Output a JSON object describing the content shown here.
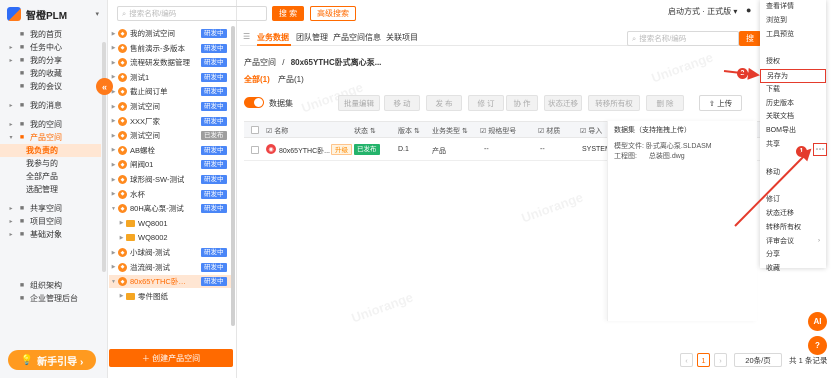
{
  "app": {
    "name": "智橙PLM"
  },
  "nav": {
    "items": [
      {
        "label": "我的首页",
        "icon": "home-icon"
      },
      {
        "label": "任务中心",
        "icon": "task-icon",
        "arrow": "▸"
      },
      {
        "label": "我的分享",
        "icon": "share-icon",
        "arrow": "▸"
      },
      {
        "label": "我的收藏",
        "icon": "star-icon"
      },
      {
        "label": "我的会议",
        "icon": "meeting-icon"
      },
      {
        "label": "我的消息",
        "icon": "message-icon",
        "arrow": "▸"
      },
      {
        "label": "我的空间",
        "icon": "space-icon",
        "arrow": "▸"
      },
      {
        "label": "产品空间",
        "icon": "product-icon",
        "arrow": "▾"
      },
      {
        "label": "我负责的"
      },
      {
        "label": "我参与的"
      },
      {
        "label": "全部产品"
      },
      {
        "label": "选配管理"
      },
      {
        "label": "共享空间",
        "icon": "shared-icon",
        "arrow": "▸"
      },
      {
        "label": "项目空间",
        "icon": "project-icon",
        "arrow": "▸"
      },
      {
        "label": "基础对象",
        "icon": "object-icon",
        "arrow": "▸"
      },
      {
        "label": "组织架构",
        "icon": "org-icon"
      },
      {
        "label": "企业管理后台",
        "icon": "admin-icon"
      }
    ],
    "guide_label": "新手引导 ›",
    "collapse_label": "«"
  },
  "tree": {
    "search_placeholder": "搜索名称/编码",
    "search_button": "搜 索",
    "advanced_button": "高级搜索",
    "items": [
      {
        "name": "我的测试空间",
        "type": "project",
        "tag": "研发中"
      },
      {
        "name": "售前演示-多版本",
        "type": "project",
        "tag": "研发中"
      },
      {
        "name": "流程研发数据管理",
        "type": "project",
        "tag": "研发中"
      },
      {
        "name": "测试1",
        "type": "project",
        "tag": "研发中"
      },
      {
        "name": "截止阀订单",
        "type": "project",
        "tag": "研发中"
      },
      {
        "name": "测试空间",
        "type": "project",
        "tag": "研发中"
      },
      {
        "name": "XXX厂家",
        "type": "project",
        "tag": "研发中"
      },
      {
        "name": "测试空间",
        "type": "project",
        "tag": "已发布"
      },
      {
        "name": "AB螺栓",
        "type": "project",
        "tag": "研发中"
      },
      {
        "name": "闸阀01",
        "type": "project",
        "tag": "研发中"
      },
      {
        "name": "球形阀-SW-测试",
        "type": "project",
        "tag": "研发中"
      },
      {
        "name": "水杯",
        "type": "project",
        "tag": "研发中"
      },
      {
        "name": "80H离心泵-测试",
        "type": "project",
        "tag": "研发中"
      },
      {
        "name": "WQ8001",
        "type": "folder",
        "tag": ""
      },
      {
        "name": "WQ8002",
        "type": "folder",
        "tag": ""
      },
      {
        "name": "小球阀-测试",
        "type": "project",
        "tag": "研发中"
      },
      {
        "name": "溢流阀-测试",
        "type": "project",
        "tag": "研发中"
      },
      {
        "name": "80x65YTHC卧式...",
        "type": "project",
        "tag": "研发中"
      },
      {
        "name": "零件图纸",
        "type": "folder",
        "tag": ""
      }
    ],
    "create_button": "＋ 创建产品空间"
  },
  "topbar": {
    "startup": "启动方式 · 正式版 ▾",
    "more": "⋯"
  },
  "main": {
    "tabs": [
      "业务数据",
      "团队管理",
      "产品空间信息",
      "关联项目"
    ],
    "search_placeholder": "搜索名称/编码",
    "search_button": "搜",
    "breadcrumb_root": "产品空间",
    "breadcrumb_sep": "/",
    "breadcrumb_current": "80x65YTHC卧式离心泵...",
    "subtabs": {
      "all": "全部(1)",
      "product": "产品(1)"
    },
    "dataset_label": "数据集",
    "toolbar": [
      "批量编辑",
      "移 动",
      "发 布",
      "修 订",
      "协 作",
      "状态迁移",
      "转移所有权",
      "删 除"
    ],
    "upload_label": "上传",
    "columns": [
      "名称",
      "状态",
      "版本",
      "业务类型",
      "规格型号",
      "材质",
      "导入"
    ],
    "row": {
      "name": "80x65YTHC卧...",
      "version_tag": "升级",
      "status": "已发布",
      "version": "D.1",
      "biz_type": "产品",
      "spec": "--",
      "material": "--",
      "import": "SYSTEM"
    },
    "preview": {
      "title": "数据集（支持拖拽上传）",
      "line1_key": "模型文件:",
      "line1_val": "卧式离心泵.SLDASM",
      "line2_key": "工程图:",
      "line2_val": "总装图.dwg"
    },
    "dots_label": "⋯"
  },
  "context_menu": [
    {
      "label": "查看详情"
    },
    {
      "label": "浏览到"
    },
    {
      "label": "工具预览"
    },
    {
      "label": ""
    },
    {
      "label": "授权"
    },
    {
      "label": "另存为",
      "highlight": true
    },
    {
      "label": "下载"
    },
    {
      "label": "历史版本"
    },
    {
      "label": "关联文档"
    },
    {
      "label": "BOM导出"
    },
    {
      "label": "共享"
    },
    {
      "label": ""
    },
    {
      "label": "移动"
    },
    {
      "label": ""
    },
    {
      "label": "修订"
    },
    {
      "label": "状态迁移"
    },
    {
      "label": "转移所有权"
    },
    {
      "label": "评审会议",
      "arrow": "›"
    },
    {
      "label": "分享"
    },
    {
      "label": "收藏"
    }
  ],
  "annotations": {
    "step1": "1",
    "step2": "2",
    "arrow_color": "#e43b2c"
  },
  "pagination": {
    "prev": "‹",
    "page": "1",
    "next": "›",
    "page_size": "20条/页",
    "total": "共 1 条记录"
  },
  "floating": {
    "ai": "AI",
    "help": "?"
  },
  "watermark": "Uniorange",
  "colors": {
    "accent": "#ff6a00",
    "tag_blue": "#4a86f7",
    "tag_gray": "#9e9e9e",
    "status_green": "#24b36b"
  }
}
